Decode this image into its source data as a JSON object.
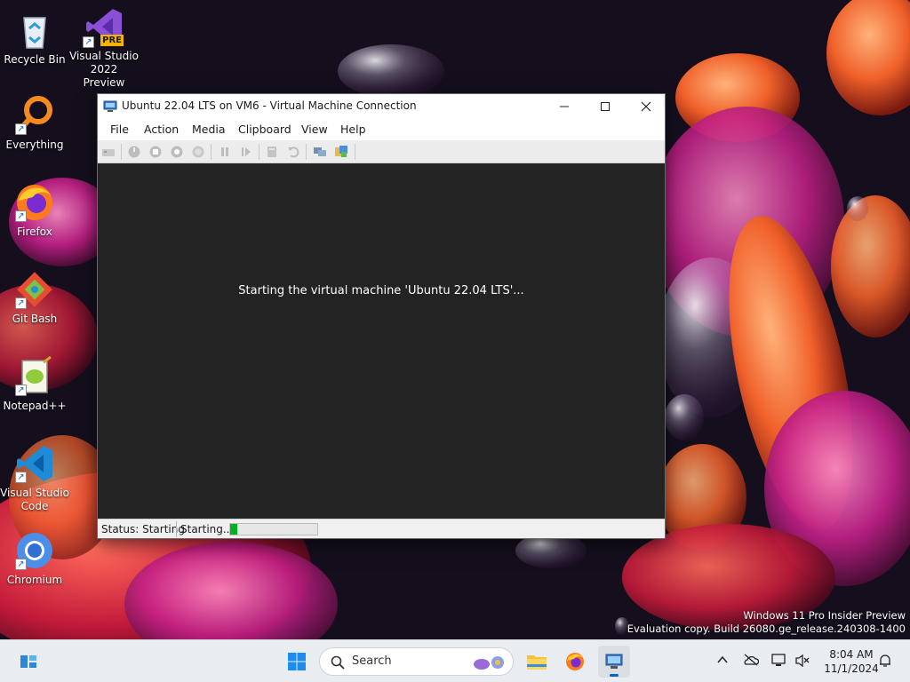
{
  "window": {
    "title": "Ubuntu 22.04 LTS on VM6 - Virtual Machine Connection",
    "menu": [
      "File",
      "Action",
      "Media",
      "Clipboard",
      "View",
      "Help"
    ],
    "toolbar_icons": [
      "ctrl-alt-del-icon",
      "start-icon",
      "turn-off-icon",
      "shutdown-icon",
      "save-icon",
      "pause-icon",
      "resume-icon",
      "checkpoint-icon",
      "revert-icon",
      "enhanced-session-icon",
      "share-icon"
    ],
    "screen_message": "Starting the virtual machine 'Ubuntu 22.04 LTS'...",
    "status": "Status: Starting",
    "progress_label": "Starting...",
    "progress_fraction": 0.08,
    "accent": "#06b025"
  },
  "desktop": {
    "icons": [
      {
        "label_lines": [
          "Recycle Bin"
        ],
        "icon": "recycle-bin-icon"
      },
      {
        "label_lines": [
          "Visual Studio",
          "2022 Preview"
        ],
        "icon": "visual-studio-icon",
        "badge": "PRE"
      },
      {
        "label_lines": [
          "Everything"
        ],
        "icon": "everything-search-icon"
      },
      {
        "label_lines": [
          "Firefox"
        ],
        "icon": "firefox-icon"
      },
      {
        "label_lines": [
          "Git Bash"
        ],
        "icon": "git-bash-icon"
      },
      {
        "label_lines": [
          "Notepad++"
        ],
        "icon": "notepad-plus-plus-icon"
      },
      {
        "label_lines": [
          "Visual Studio",
          "Code"
        ],
        "icon": "vscode-icon"
      },
      {
        "label_lines": [
          "Chromium"
        ],
        "icon": "chromium-icon"
      }
    ],
    "watermark": {
      "line1": "Windows 11 Pro Insider Preview",
      "line2": "Evaluation copy. Build 26080.ge_release.240308-1400"
    }
  },
  "taskbar": {
    "search_placeholder": "Search",
    "pinned": [
      "widgets-icon",
      "start-icon",
      "search",
      "file-explorer-icon",
      "firefox-icon",
      "hyper-v-manager-icon"
    ],
    "tray": [
      "chevron-up-icon",
      "onedrive-icon",
      "network-icon",
      "volume-muted-icon",
      "notification-bell-icon"
    ],
    "clock_time": "8:04 AM",
    "clock_date": "11/1/2024"
  }
}
